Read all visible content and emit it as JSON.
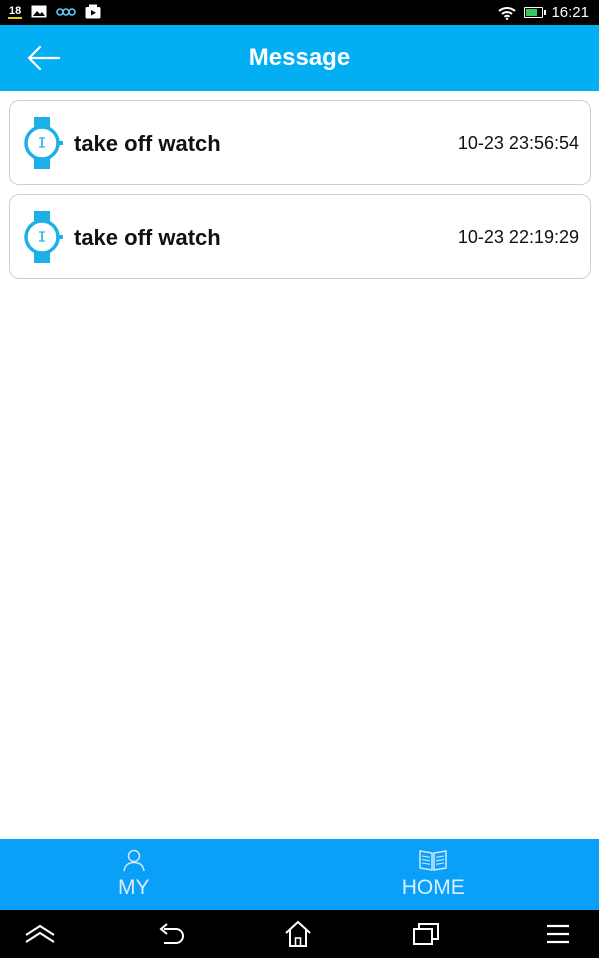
{
  "status_bar": {
    "notification_badge": "18",
    "time": "16:21",
    "icons": [
      "picture-icon",
      "eco-icon",
      "camera-icon",
      "wifi-icon",
      "battery-icon"
    ]
  },
  "header": {
    "title": "Message",
    "back_icon": "arrow-left-icon"
  },
  "messages": [
    {
      "icon": "watch-icon",
      "title": "take off watch",
      "time": "10-23 23:56:54"
    },
    {
      "icon": "watch-icon",
      "title": "take off watch",
      "time": "10-23 22:19:29"
    }
  ],
  "bottom_nav": {
    "items": [
      {
        "label": "MY",
        "icon": "person-icon"
      },
      {
        "label": "HOME",
        "icon": "book-icon"
      }
    ]
  },
  "system_nav": {
    "icons": [
      "collapse-icon",
      "back-icon",
      "home-icon",
      "recent-apps-icon",
      "menu-icon"
    ]
  },
  "colors": {
    "header_bg": "#03aef3",
    "bottom_nav_bg": "#0aa0f7",
    "watch_icon": "#1cb0e8",
    "status_bar_bg": "#000000"
  }
}
